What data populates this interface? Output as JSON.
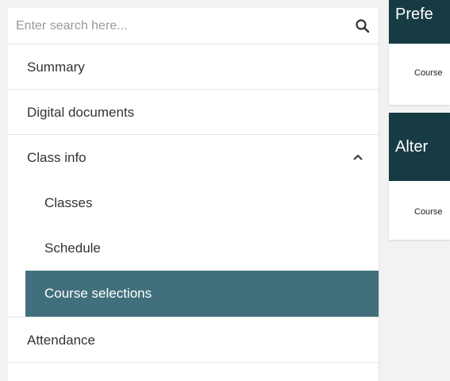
{
  "search": {
    "placeholder": "Enter search here..."
  },
  "nav": {
    "summary": "Summary",
    "digital_documents": "Digital documents",
    "class_info": "Class info",
    "sub_items": [
      "Classes",
      "Schedule",
      "Course selections"
    ],
    "attendance": "Attendance",
    "active_item": "Course selections"
  },
  "cards": [
    {
      "title": "Prefe",
      "body": "Course"
    },
    {
      "title": "Alter",
      "body": "Course"
    }
  ],
  "colors": {
    "active_bg": "#41707c",
    "card_header_bg": "#173b44",
    "page_bg": "#f2f2f2"
  }
}
